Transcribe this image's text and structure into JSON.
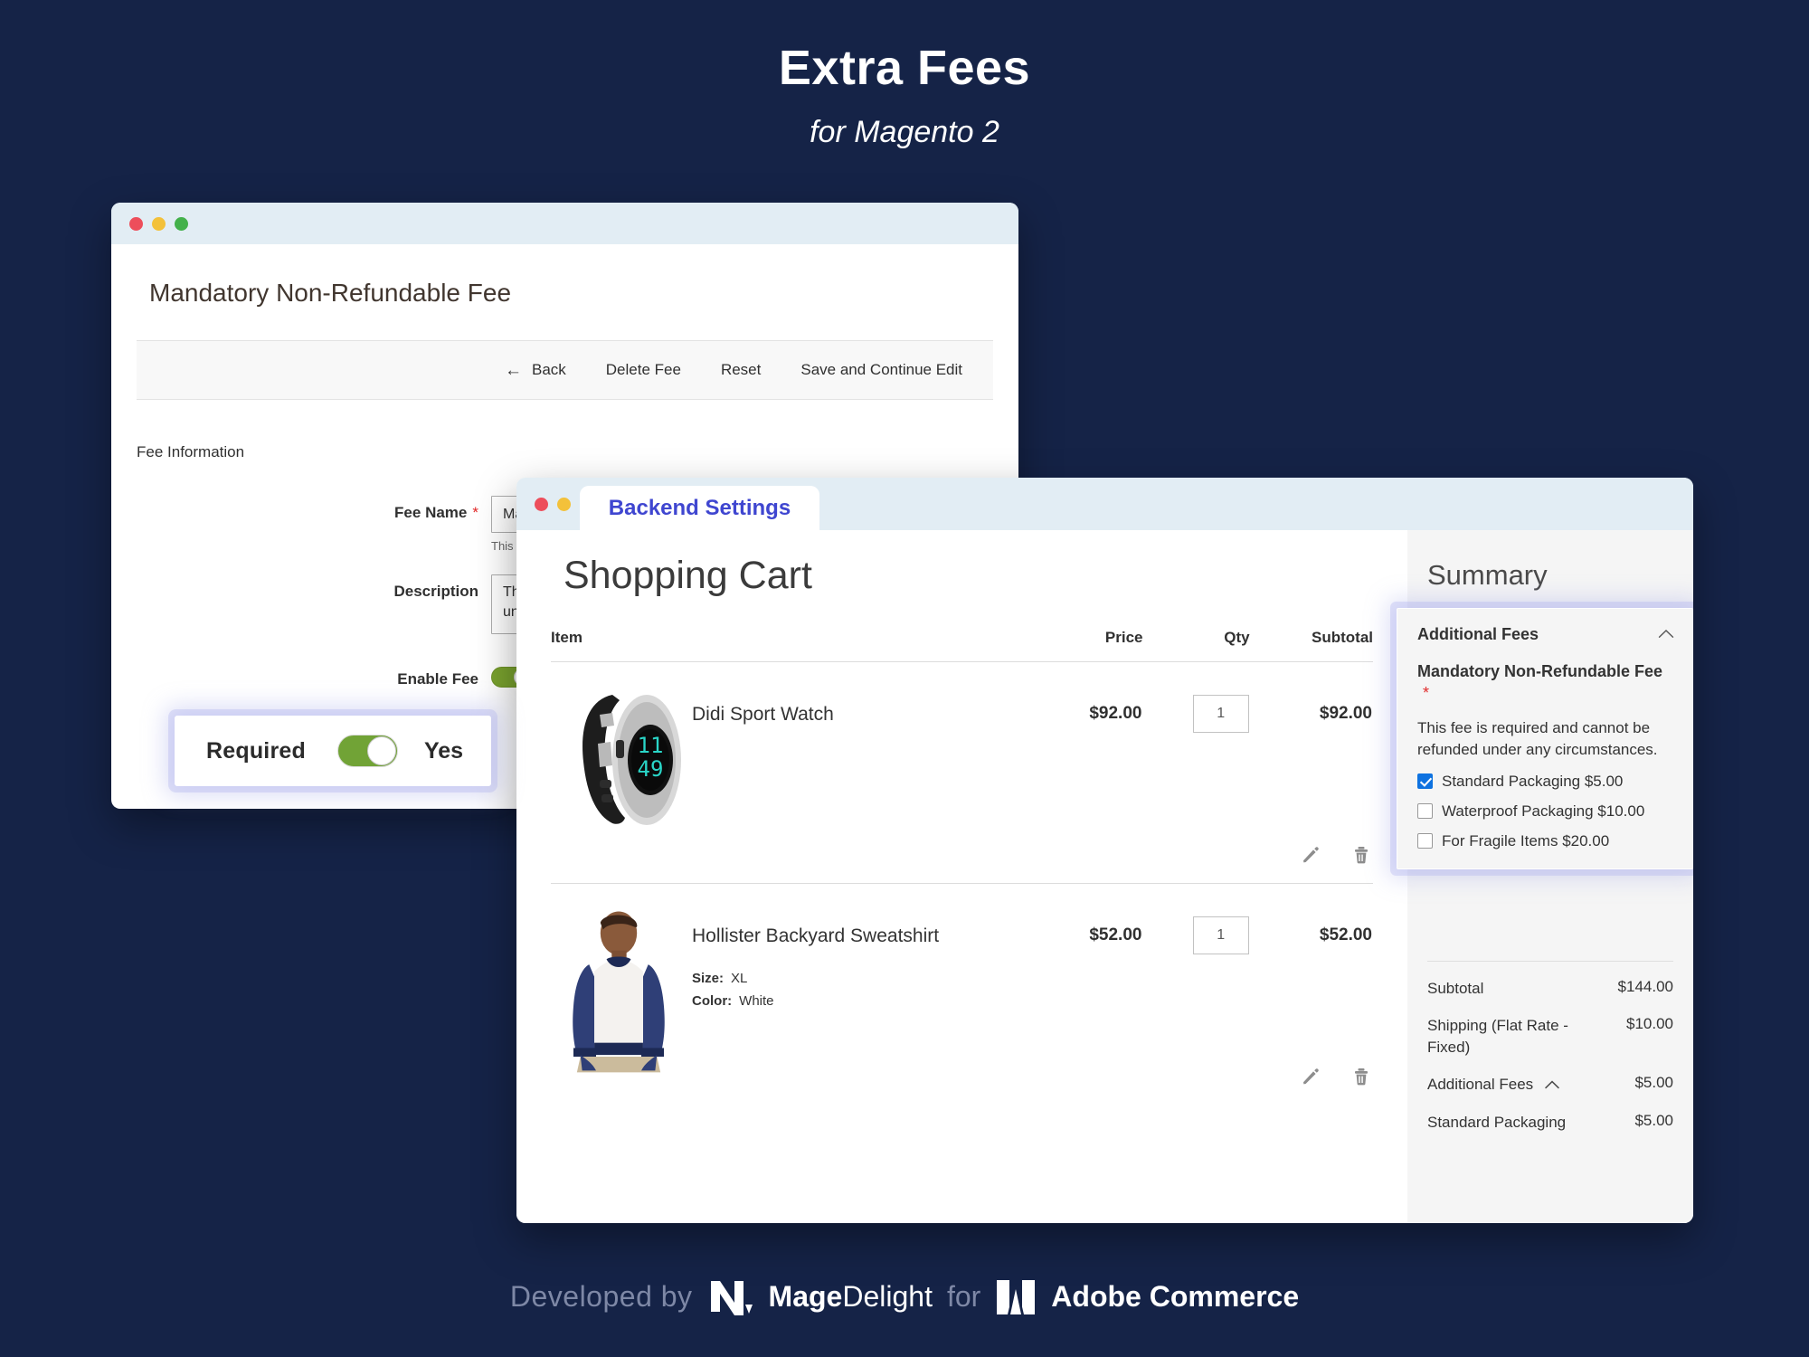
{
  "hero": {
    "title": "Extra Fees",
    "subtitle": "for Magento 2"
  },
  "colors": {
    "background": "#152347",
    "accent_blue": "#3f46d0",
    "toggle_green": "#71a336",
    "required_red": "#e02b2b",
    "checkbox_blue": "#0e72e0",
    "titlebar": "#e2edf4"
  },
  "admin_window": {
    "page_title": "Mandatory Non-Refundable Fee",
    "toolbar": {
      "back_label": "Back",
      "delete_label": "Delete Fee",
      "reset_label": "Reset",
      "save_label": "Save and Continue Edit"
    },
    "section_label": "Fee Information",
    "fields": {
      "fee_name_label": "Fee Name",
      "fee_name_value": "Mandatory Non-Refundable Fee",
      "fee_name_hint": "This will be displayed on store front",
      "description_label": "Description",
      "description_value": "This fee is required and cannot be refunded under any circumstances.",
      "enable_fee_label": "Enable Fee",
      "enable_fee_value": "Yes"
    },
    "callout": {
      "label": "Required",
      "value": "Yes"
    }
  },
  "cart_window": {
    "tab_label": "Backend Settings",
    "page_title": "Shopping Cart",
    "table": {
      "headers": {
        "item": "Item",
        "price": "Price",
        "qty": "Qty",
        "subtotal": "Subtotal"
      },
      "rows": [
        {
          "name": "Didi Sport Watch",
          "price": "$92.00",
          "qty": "1",
          "subtotal": "$92.00",
          "options": []
        },
        {
          "name": "Hollister Backyard Sweatshirt",
          "price": "$52.00",
          "qty": "1",
          "subtotal": "$52.00",
          "options": [
            {
              "label": "Size:",
              "value": "XL"
            },
            {
              "label": "Color:",
              "value": "White"
            }
          ]
        }
      ]
    },
    "summary": {
      "heading": "Summary",
      "additional_fees": {
        "heading": "Additional Fees",
        "fee_title": "Mandatory Non-Refundable Fee",
        "fee_required_marker": "*",
        "fee_description": "This fee is required and cannot be refunded under any circumstances.",
        "options": [
          {
            "label": "Standard Packaging $5.00",
            "checked": true
          },
          {
            "label": "Waterproof Packaging $10.00",
            "checked": false
          },
          {
            "label": "For Fragile Items $20.00",
            "checked": false
          }
        ]
      },
      "totals": [
        {
          "label": "Subtotal",
          "value": "$144.00",
          "caret": false
        },
        {
          "label": "Shipping (Flat Rate - Fixed)",
          "value": "$10.00",
          "caret": false
        },
        {
          "label": "Additional Fees",
          "value": "$5.00",
          "caret": true
        },
        {
          "label": "Standard Packaging",
          "value": "$5.00",
          "caret": false
        }
      ]
    }
  },
  "footer": {
    "developed_by": "Developed by",
    "mage": "Mage",
    "delight": "Delight",
    "for": "for",
    "adobe": "Adobe",
    "commerce": "Commerce"
  }
}
